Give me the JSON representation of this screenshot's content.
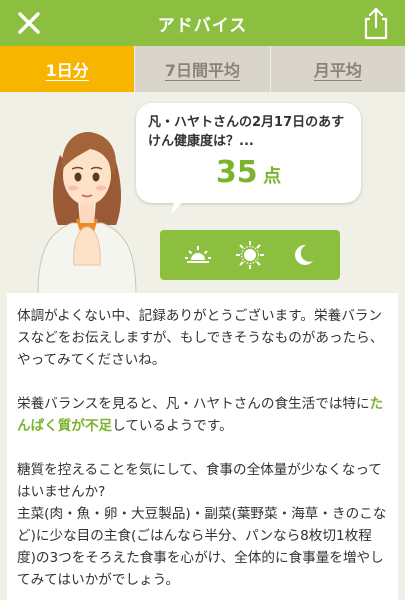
{
  "header": {
    "title": "アドバイス",
    "close_icon": "close-icon",
    "share_icon": "share-icon"
  },
  "tabs": [
    {
      "label": "1日分",
      "active": true
    },
    {
      "label": "7日間平均",
      "active": false
    },
    {
      "label": "月平均",
      "active": false
    }
  ],
  "bubble": {
    "question": "凡・ハヤトさんの2月17日のあすけん健康度は？...",
    "score": "35",
    "unit": "点"
  },
  "time_icons": [
    "sunrise-icon",
    "sun-icon",
    "moon-icon"
  ],
  "advice": {
    "p1": "体調がよくない中、記録ありがとうございます。栄養バランスなどをお伝えしますが、もしできそうなものがあったら、やってみてくださいね。",
    "p2_before": "栄養バランスを見ると、凡・ハヤトさんの食生活では特に",
    "p2_highlight": "たんぱく質が不足",
    "p2_after": "しているようです。",
    "p3": "糖質を控えることを気にして、食事の全体量が少なくなってはいませんか?",
    "p4": "主菜(肉・魚・卵・大豆製品)・副菜(葉野菜・海草・きのこなど)に少な目の主食(ごはんなら半分、パンなら8枚切1枚程度)の3つをそろえた食事を心がけ、全体的に食事量を増やしてみてはいかがでしょう。"
  },
  "colors": {
    "header_green": "#8cbf3f",
    "active_tab": "#f7b500",
    "inactive_tab": "#d9d5cb",
    "accent_green": "#7bb32e"
  }
}
